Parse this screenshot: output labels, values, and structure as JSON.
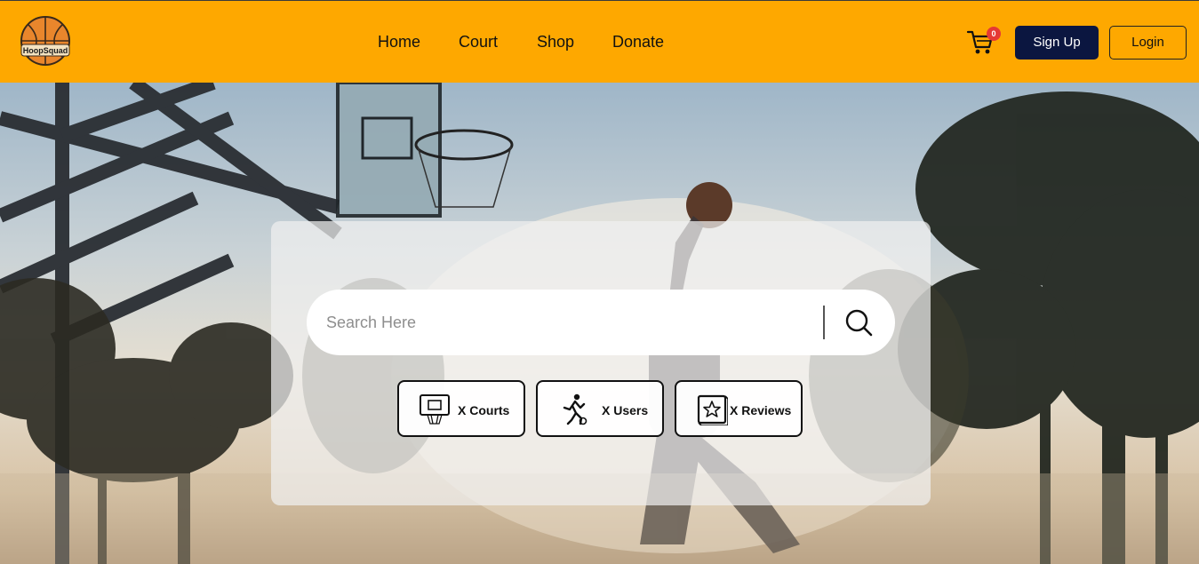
{
  "header": {
    "logo_text": "HoopSquad",
    "nav": [
      "Home",
      "Court",
      "Shop",
      "Donate"
    ],
    "cart_count": "0",
    "signup_label": "Sign Up",
    "login_label": "Login"
  },
  "search": {
    "placeholder": "Search Here"
  },
  "stats": [
    {
      "label": "X Courts",
      "icon": "hoop-icon"
    },
    {
      "label": "X Users",
      "icon": "player-icon"
    },
    {
      "label": "X Reviews",
      "icon": "star-icon"
    }
  ],
  "colors": {
    "header_bg": "#fea800",
    "signup_bg": "#0b1640",
    "badge": "#e53935"
  }
}
